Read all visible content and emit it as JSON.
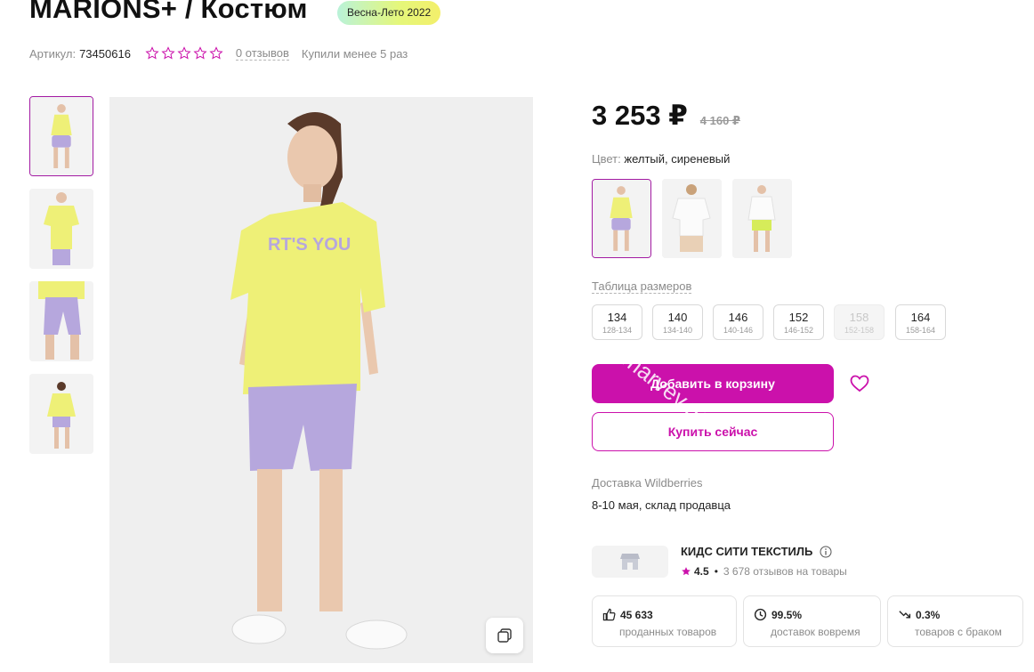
{
  "product": {
    "title": "MARIONS+ / Костюм",
    "season_badge": "Весна-Лето 2022",
    "article_label": "Артикул:",
    "article_value": "73450616",
    "rating_stars": 0,
    "reviews_link": "0 отзывов",
    "bought_text": "Купили менее 5 раз"
  },
  "gallery": {
    "thumbnails": [
      "yellow-tshirt-lilac-shorts-front",
      "yellow-tshirt-front-crop",
      "lilac-shorts-closeup",
      "yellow-tshirt-back"
    ],
    "active_index": 0
  },
  "pricing": {
    "price": "3 253 ₽",
    "old_price": "4 160 ₽"
  },
  "color": {
    "label": "Цвет:",
    "value": "желтый, сиреневый",
    "swatches": [
      "yellow-lilac",
      "white-beige",
      "white-lime"
    ],
    "active_index": 0
  },
  "sizes": {
    "table_link": "Таблица размеров",
    "items": [
      {
        "size": "134",
        "range": "128-134",
        "available": true
      },
      {
        "size": "140",
        "range": "134-140",
        "available": true
      },
      {
        "size": "146",
        "range": "140-146",
        "available": true
      },
      {
        "size": "152",
        "range": "146-152",
        "available": true
      },
      {
        "size": "158",
        "range": "152-158",
        "available": false
      },
      {
        "size": "164",
        "range": "158-164",
        "available": true
      }
    ]
  },
  "actions": {
    "add_to_cart": "Добавить в корзину",
    "buy_now": "Купить сейчас",
    "favorite_icon": "heart-icon"
  },
  "delivery": {
    "label": "Доставка Wildberries",
    "value": "8-10 мая, склад продавца"
  },
  "seller": {
    "name": "КИДС СИТИ ТЕКСТИЛЬ",
    "rating": "4.5",
    "reviews": "3 678 отзывов на товары"
  },
  "stats": [
    {
      "icon": "thumbs-up-icon",
      "value": "45 633",
      "label": "проданных товаров"
    },
    {
      "icon": "clock-icon",
      "value": "99.5%",
      "label": "доставок вовремя"
    },
    {
      "icon": "trend-down-icon",
      "value": "0.3%",
      "label": "товаров с браком"
    }
  ],
  "watermark": "marvev.ru",
  "colors": {
    "accent": "#cb11ab",
    "active_border": "#a31ba3",
    "tshirt_yellow": "#eef077",
    "shorts_lilac": "#b6a7dd"
  }
}
